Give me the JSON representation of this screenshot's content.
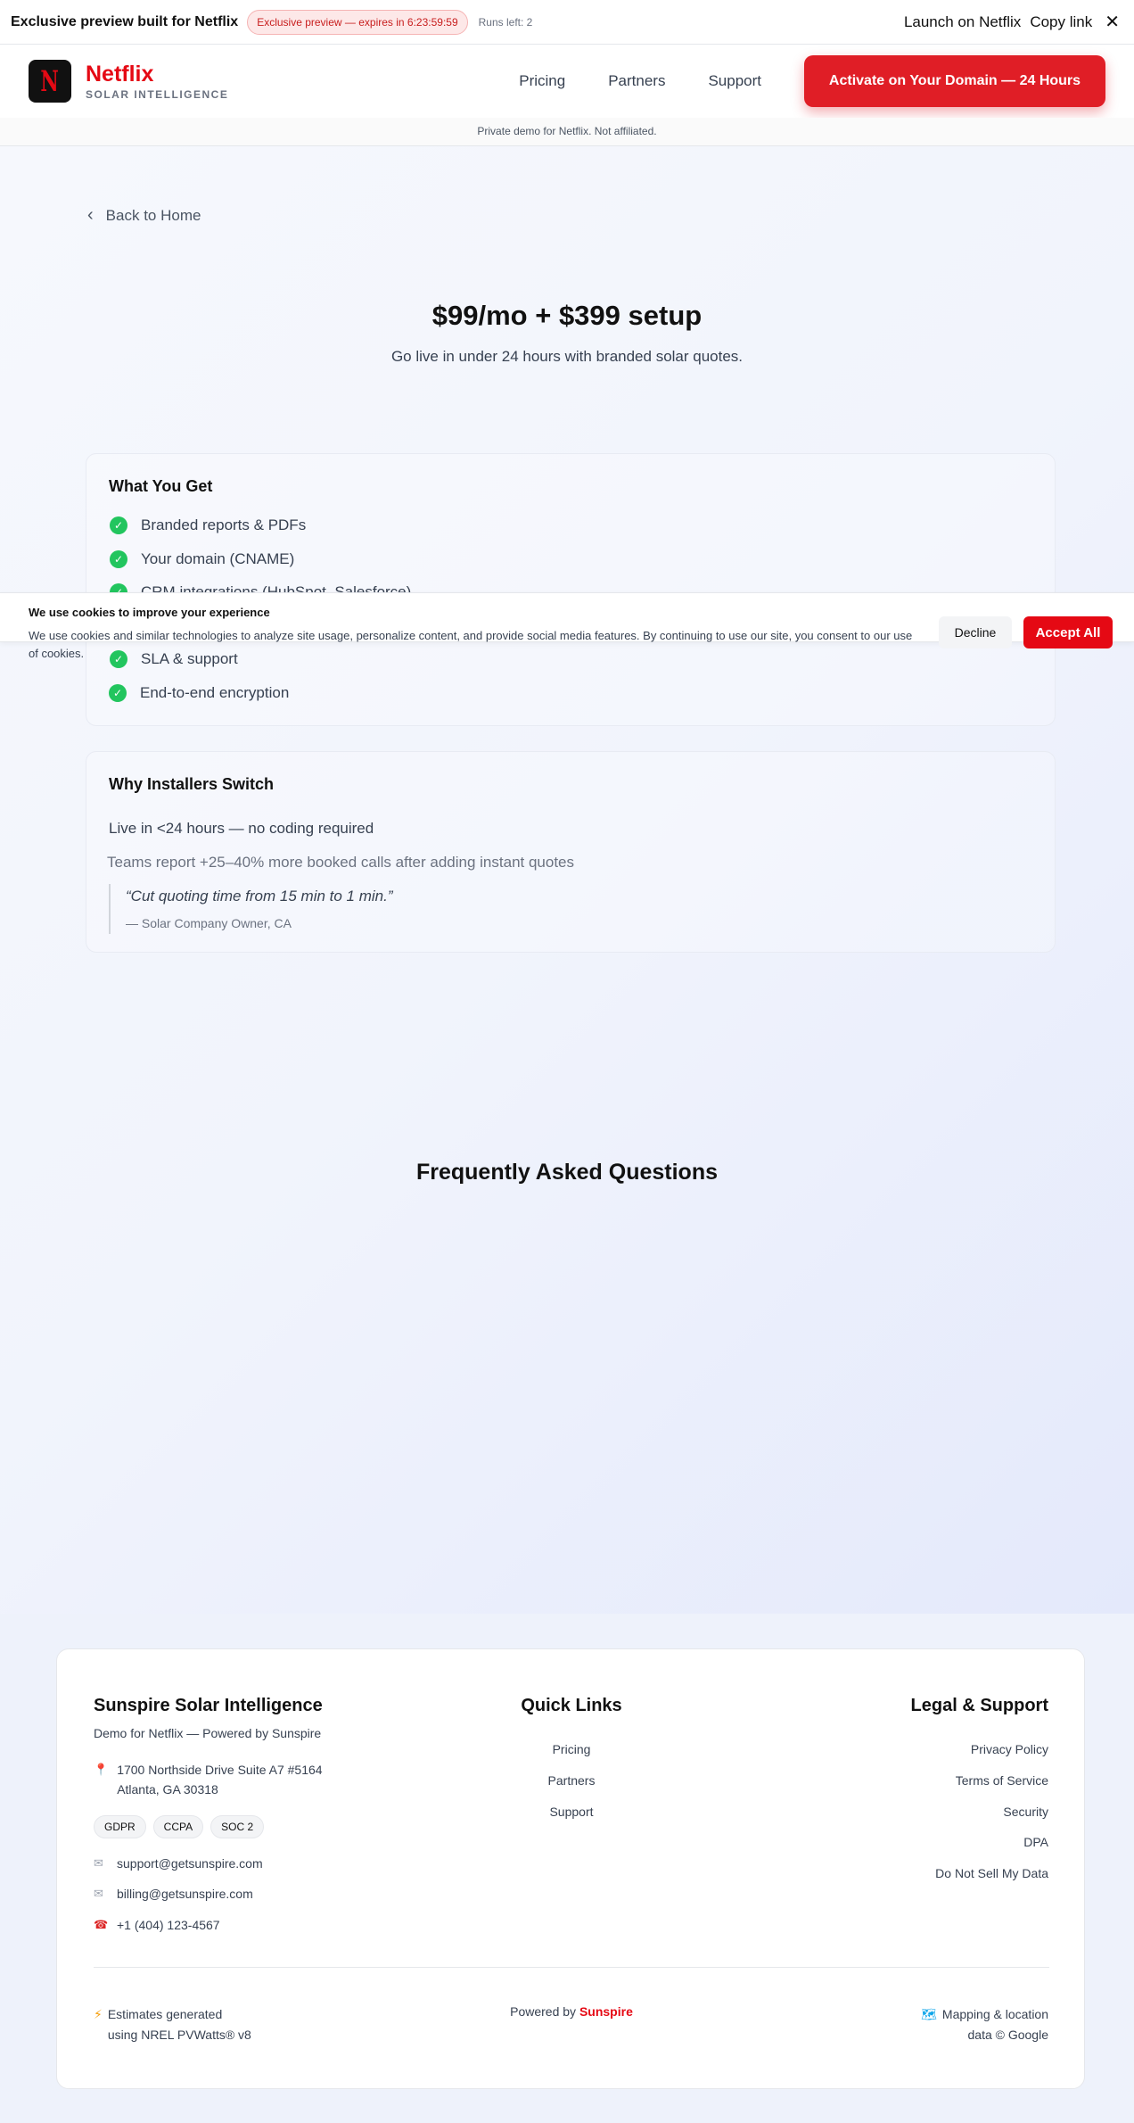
{
  "topbar": {
    "title": "Exclusive preview built for Netflix",
    "badge": "Exclusive preview — expires in 6:23:59:59",
    "runs": "Runs left: 2",
    "launch": "Launch on Netflix",
    "copy": "Copy link",
    "close": "✕"
  },
  "header": {
    "logo_letter": "N",
    "brand_name": "Netflix",
    "brand_sub": "SOLAR INTELLIGENCE",
    "nav": [
      "Pricing",
      "Partners",
      "Support"
    ],
    "cta": "Activate on Your Domain — 24 Hours"
  },
  "notice": "Private demo for Netflix. Not affiliated.",
  "back": "Back to Home",
  "hero": {
    "title": "$99/mo + $399 setup",
    "subtitle": "Go live in under 24 hours with branded solar quotes."
  },
  "what_you_get": {
    "title": "What You Get",
    "items": [
      "Branded reports & PDFs",
      "Your domain (CNAME)",
      "CRM integrations (HubSpot, Salesforce)",
      "SLA & support",
      "End-to-end encryption"
    ]
  },
  "why": {
    "title": "Why Installers Switch",
    "line1": "Live in <24 hours — no coding required",
    "line2": "Teams report +25–40% more booked calls after adding instant quotes",
    "quote": "“Cut quoting time from 15 min to 1 min.”",
    "author": "— Solar Company Owner, CA"
  },
  "faq_title": "Frequently Asked Questions",
  "cookie": {
    "title": "We use cookies to improve your experience",
    "body": "We use cookies and similar technologies to analyze site usage, personalize content, and provide social media features. By continuing to use our site, you consent to our use of cookies.",
    "decline": "Decline",
    "accept": "Accept All"
  },
  "footer": {
    "company": "Sunspire Solar Intelligence",
    "subtitle": "Demo for Netflix — Powered by Sunspire",
    "address1": "1700 Northside Drive Suite A7 #5164",
    "address2": "Atlanta, GA 30318",
    "tags": [
      "GDPR",
      "CCPA",
      "SOC 2"
    ],
    "email_support": "support@getsunspire.com",
    "email_billing": "billing@getsunspire.com",
    "phone": "+1 (404) 123-4567",
    "quick_title": "Quick Links",
    "quick_links": [
      "Pricing",
      "Partners",
      "Support"
    ],
    "legal_title": "Legal & Support",
    "legal_links": [
      "Privacy Policy",
      "Terms of Service",
      "Security",
      "DPA",
      "Do Not Sell My Data"
    ],
    "estimates1": "Estimates generated",
    "estimates2": "using NREL PVWatts® v8",
    "powered_prefix": "Powered by",
    "powered_brand": "Sunspire",
    "map1": "Mapping & location",
    "map2": "data © Google"
  },
  "icons": {
    "back": "chevron-left-icon",
    "check": "check-circle-icon",
    "pin": "map-pin-icon",
    "mail": "mail-icon",
    "phone": "phone-icon",
    "bolt": "lightning-icon",
    "map": "map-icon"
  },
  "colors": {
    "brand_red": "#e50914",
    "cta_red": "#e01e26",
    "check_green": "#22c55e"
  }
}
